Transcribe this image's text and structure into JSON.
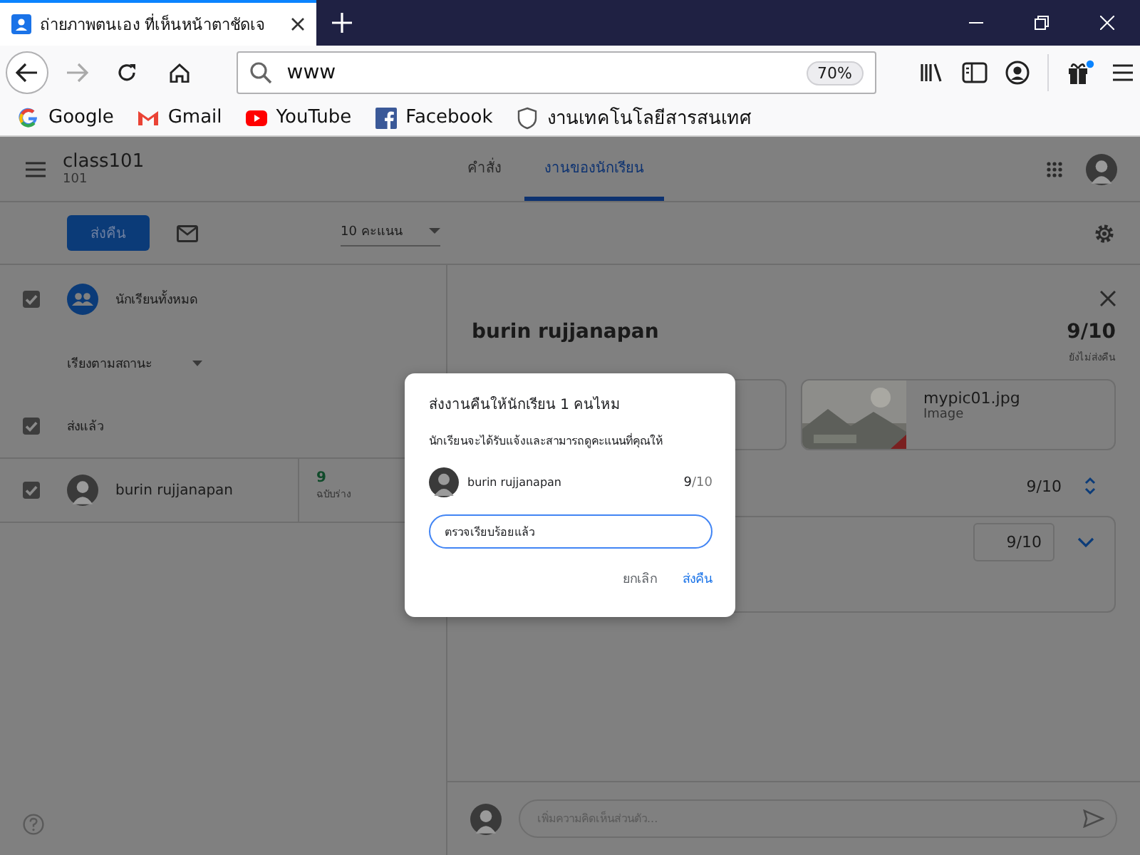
{
  "browser": {
    "tab": {
      "title": "ถ่ายภาพตนเอง ที่เห็นหน้าตาชัดเจ"
    },
    "address": {
      "value": "www",
      "zoom": "70%"
    },
    "bookmarks": [
      {
        "label": "Google",
        "kind": "google"
      },
      {
        "label": "Gmail",
        "kind": "gmail"
      },
      {
        "label": "YouTube",
        "kind": "youtube"
      },
      {
        "label": "Facebook",
        "kind": "facebook"
      },
      {
        "label": "งานเทคโนโลยีสารสนเทศ",
        "kind": "shield"
      }
    ]
  },
  "app": {
    "class_name": "class101",
    "section": "101",
    "tabs": [
      {
        "label": "คำสั่ง",
        "selected": false
      },
      {
        "label": "งานของนักเรียน",
        "selected": true
      }
    ]
  },
  "toolbar": {
    "return_button": "ส่งคืน",
    "points": "10 คะแนน"
  },
  "roster": {
    "all_students": {
      "label": "นักเรียนทั้งหมด",
      "checked": true
    },
    "sort": "เรียงตามสถานะ",
    "groups": [
      {
        "label": "ส่งแล้ว",
        "checked": true,
        "students": [
          {
            "name": "burin rujjanapan",
            "checked": true,
            "grade": "9",
            "grade_status": "ฉบับร่าง"
          }
        ]
      }
    ]
  },
  "detail": {
    "name": "burin rujjanapan",
    "grade": "9/10",
    "grade_status": "ยังไม่ส่งคืน",
    "attachments": [
      {
        "kind": "hidden"
      },
      {
        "name": "mypic01.jpg",
        "type": "Image"
      }
    ],
    "grade_row": "9/10",
    "grade_field": "9/10"
  },
  "comment": {
    "placeholder": "เพิ่มความคิดเห็นส่วนตัว..."
  },
  "dialog": {
    "title": "ส่งงานคืนให้นักเรียน 1 คนไหม",
    "message": "นักเรียนจะได้รับแจ้งและสามารถดูคะแนนที่คุณให้",
    "student": {
      "name": "burin rujjanapan",
      "grade": "**9**/10"
    },
    "comment": "ตรวจเรียบร้อยแล้ว",
    "buttons": [
      {
        "label": "ยกเลิก",
        "kind": "cancel"
      },
      {
        "label": "ส่งคืน",
        "kind": "confirm"
      }
    ]
  }
}
